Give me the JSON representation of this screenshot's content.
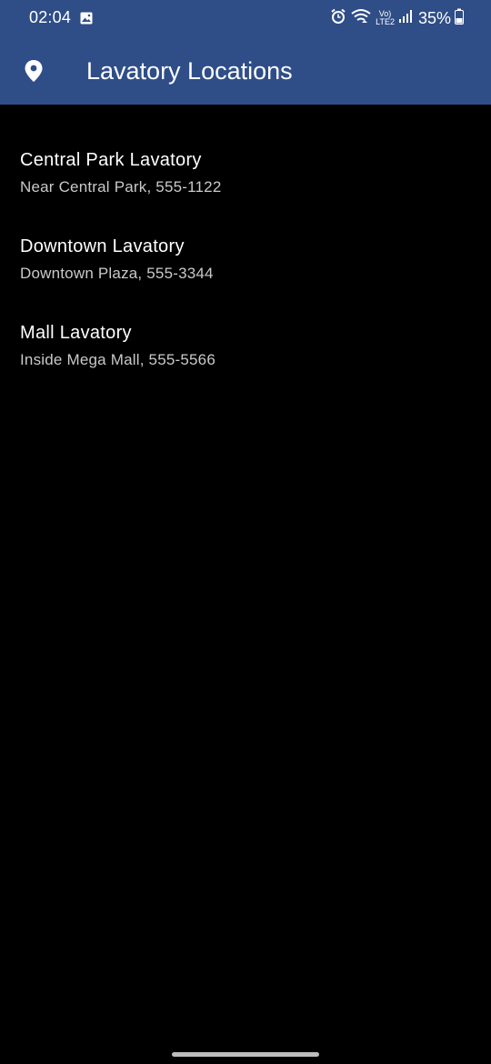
{
  "status_bar": {
    "time": "02:04",
    "battery_percent": "35%",
    "network_label_top": "Vo)",
    "network_label_bottom": "LTE2",
    "icons": [
      "gallery-icon",
      "alarm-icon",
      "wifi-icon",
      "signal-icon",
      "battery-icon"
    ]
  },
  "app_bar": {
    "title": "Lavatory Locations",
    "icon": "location-pin-icon",
    "background_color": "#2f4e87"
  },
  "locations": [
    {
      "name": "Central Park Lavatory",
      "details": "Near Central Park, 555-1122"
    },
    {
      "name": "Downtown Lavatory",
      "details": "Downtown Plaza, 555-3344"
    },
    {
      "name": "Mall Lavatory",
      "details": "Inside Mega Mall, 555-5566"
    }
  ]
}
